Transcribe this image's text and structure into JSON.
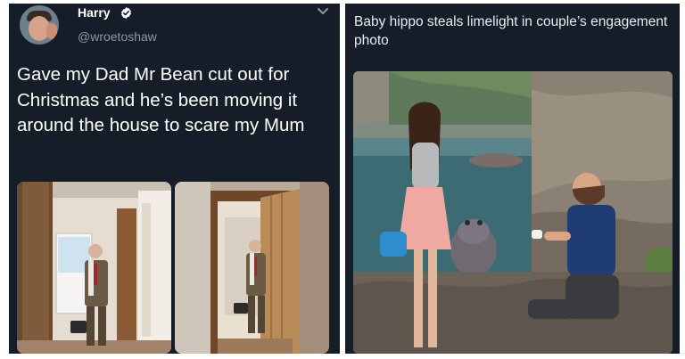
{
  "left_tweet": {
    "author_name": "Harry",
    "handle": "@wroetoshaw",
    "text": "Gave my Dad Mr Bean cut out for Christmas and he’s been moving it around the house to scare my Mum",
    "images": [
      {
        "description": "hallway"
      },
      {
        "description": "doorway"
      }
    ]
  },
  "right_post": {
    "title": "Baby hippo steals limelight in couple’s engagement photo",
    "image": {
      "description": "engagement-photo"
    }
  },
  "colors": {
    "panel_bg": "#151d28",
    "text_primary": "#ffffff",
    "text_secondary": "#8a97a5",
    "verified": "#ffffff"
  },
  "icons": [
    "verified-icon",
    "chevron-down-icon"
  ]
}
